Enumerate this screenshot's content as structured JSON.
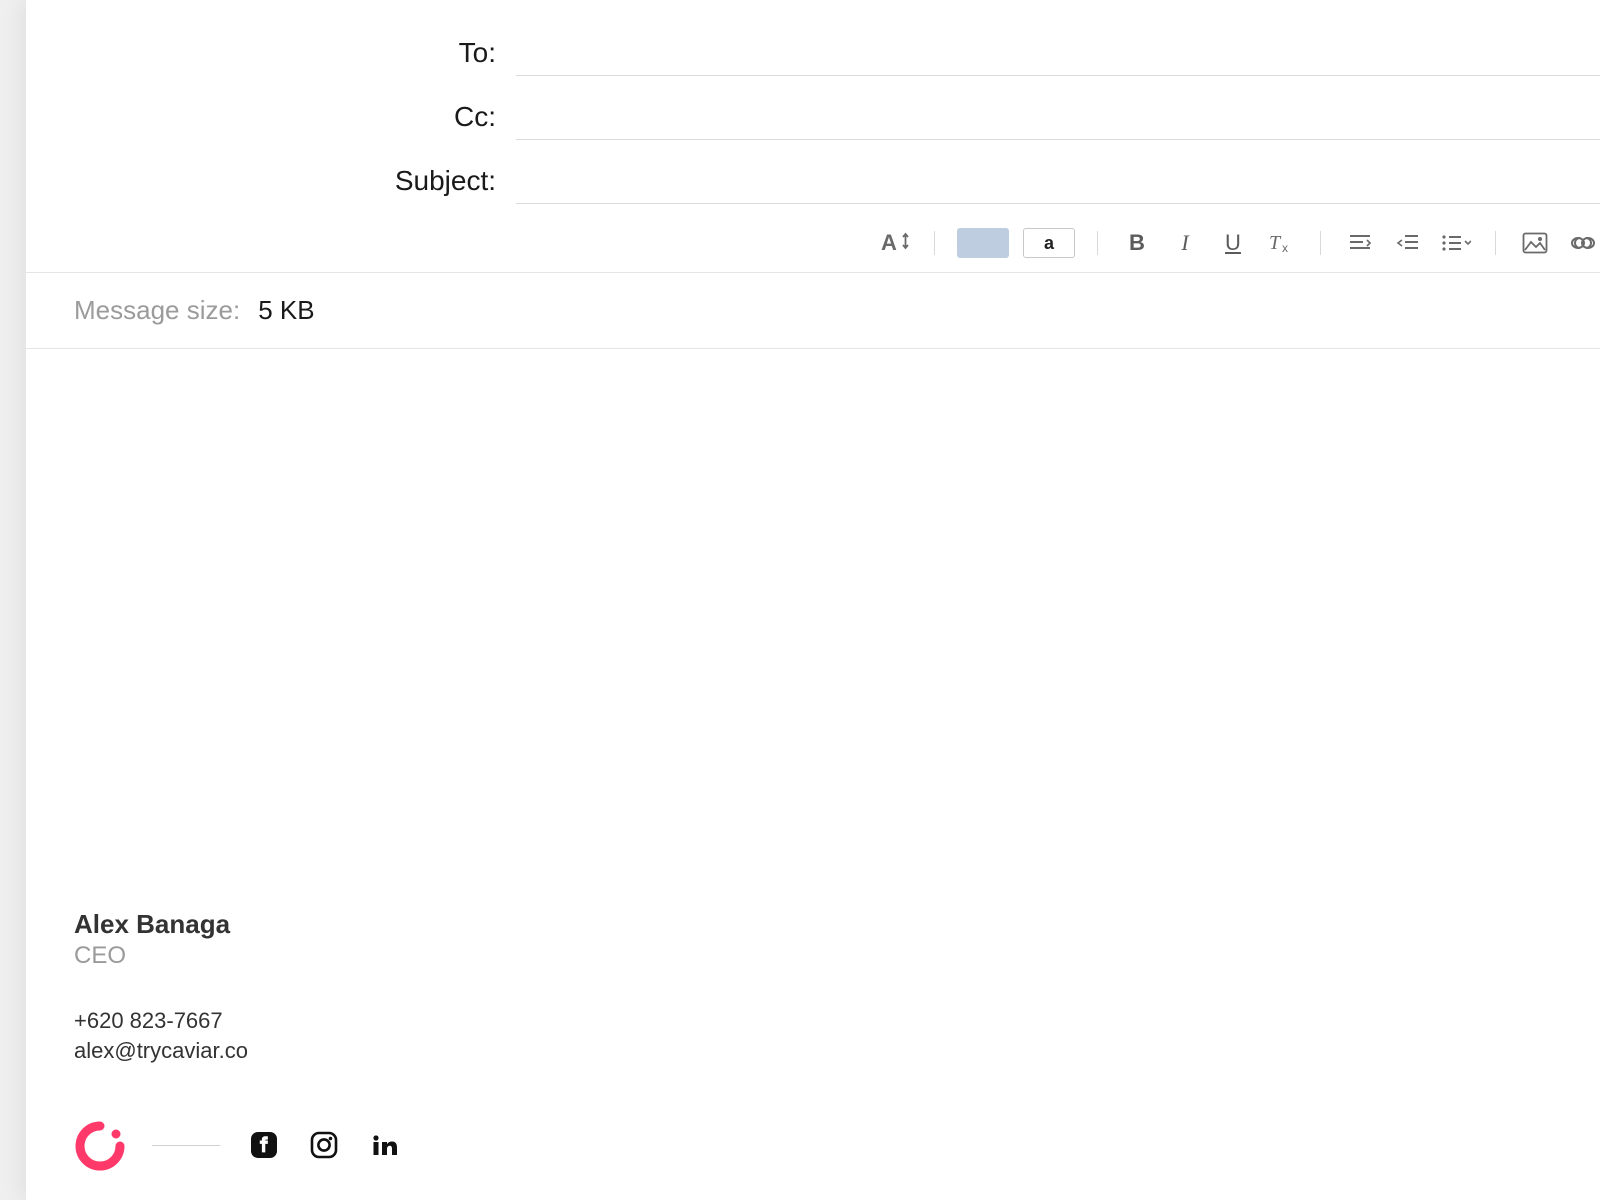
{
  "fields": {
    "to_label": "To:",
    "to_value": "",
    "cc_label": "Cc:",
    "cc_value": "",
    "subject_label": "Subject:",
    "subject_value": ""
  },
  "toolbar": {
    "text_color_sample": "a"
  },
  "info": {
    "message_size_label": "Message size:",
    "message_size_value": "5 KB"
  },
  "signature": {
    "name": "Alex Banaga",
    "title": "CEO",
    "phone": "+620 823-7667",
    "email": "alex@trycaviar.co"
  },
  "icons": {
    "logo_color": "#ff3a6b"
  }
}
